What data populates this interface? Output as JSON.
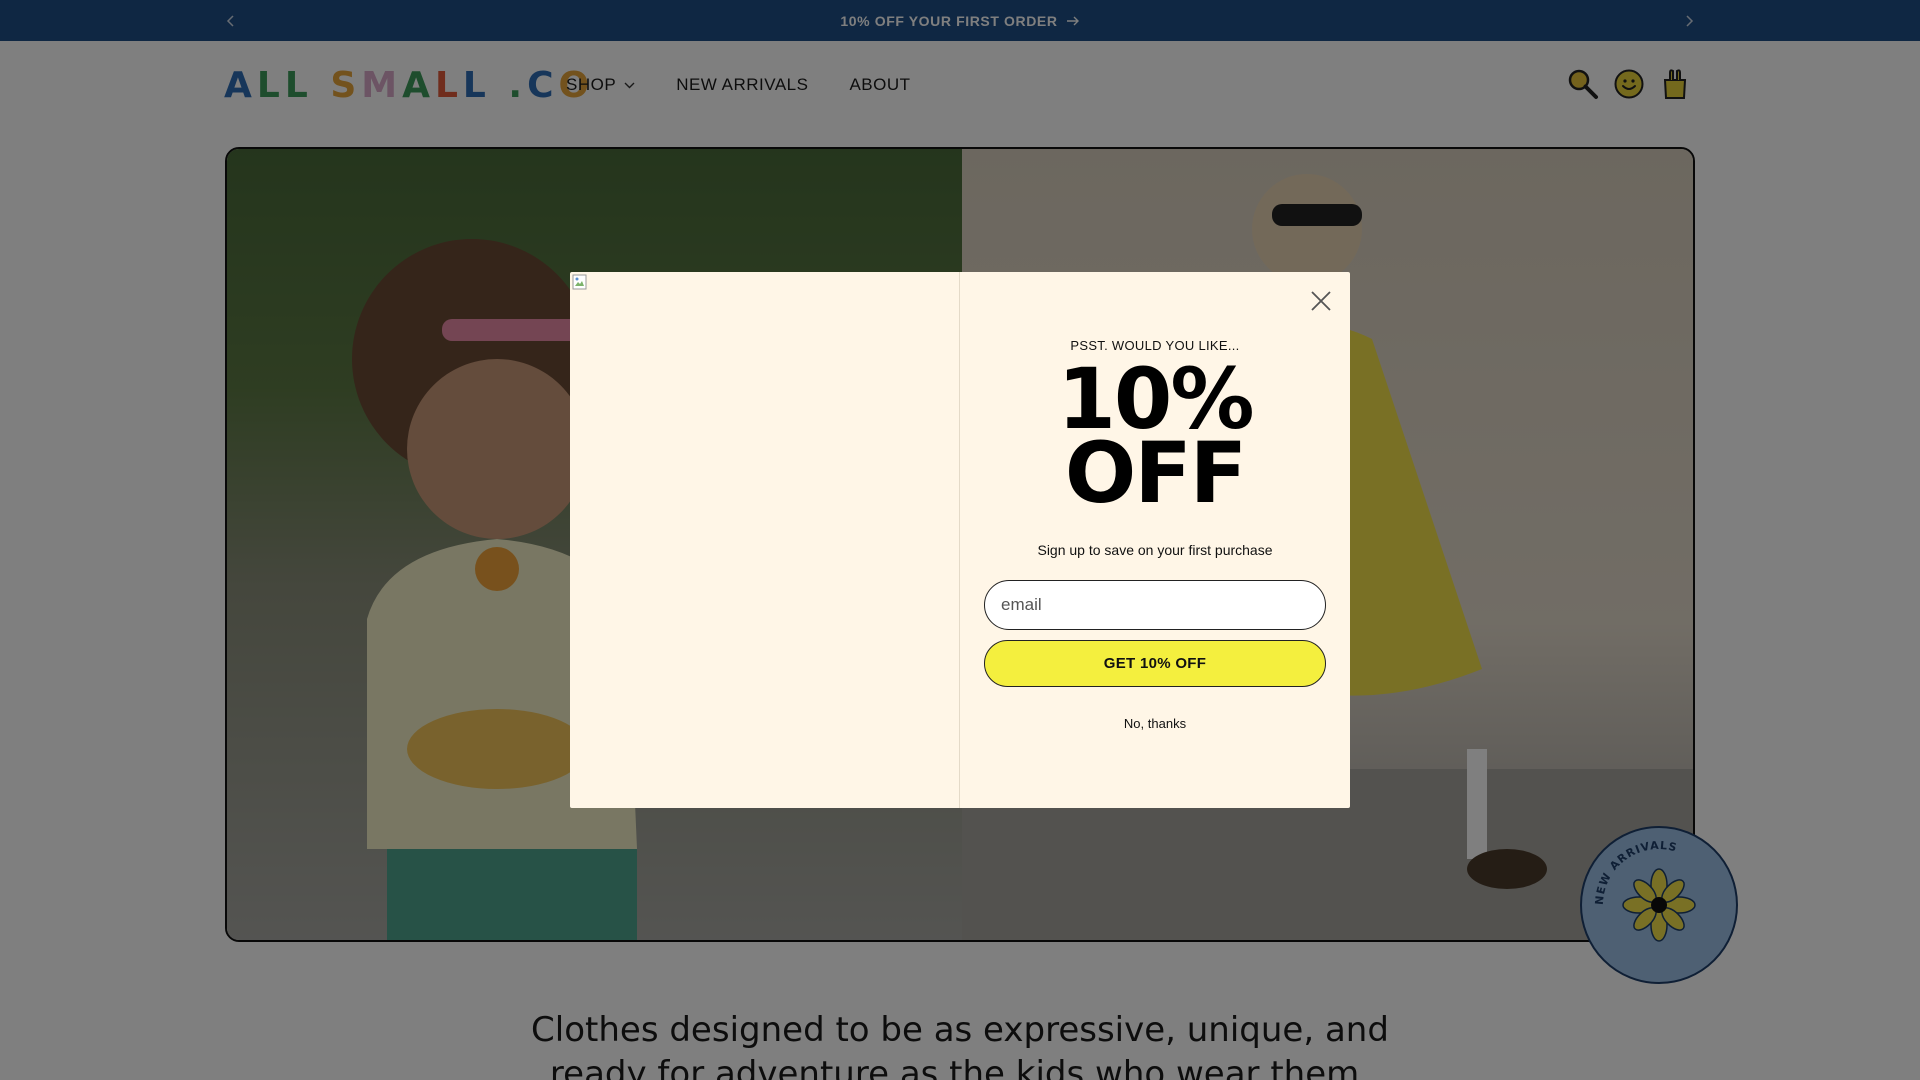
{
  "announcement": {
    "text": "10% OFF YOUR FIRST ORDER",
    "prev_icon": "chevron-left-icon",
    "next_icon": "chevron-right-icon",
    "arrow_icon": "arrow-right-icon"
  },
  "header": {
    "logo": {
      "text": "ALL SMALL .CO",
      "letters": [
        {
          "ch": "A",
          "color": "#2f6db5"
        },
        {
          "ch": "L",
          "color": "#3d9a5a"
        },
        {
          "ch": "L",
          "color": "#3d9a5a"
        },
        {
          "ch": " ",
          "color": "#000000"
        },
        {
          "ch": "S",
          "color": "#e6a43a"
        },
        {
          "ch": "M",
          "color": "#d9a8c9"
        },
        {
          "ch": "A",
          "color": "#3d9a5a"
        },
        {
          "ch": "L",
          "color": "#e05a3a"
        },
        {
          "ch": "L",
          "color": "#2f6db5"
        },
        {
          "ch": " ",
          "color": "#000000"
        },
        {
          "ch": ".",
          "color": "#3d9a5a"
        },
        {
          "ch": "C",
          "color": "#2f6db5"
        },
        {
          "ch": "O",
          "color": "#e6a43a"
        }
      ]
    },
    "nav": [
      {
        "label": "SHOP",
        "has_dropdown": true
      },
      {
        "label": "NEW ARRIVALS",
        "has_dropdown": false
      },
      {
        "label": "ABOUT",
        "has_dropdown": false
      }
    ],
    "icons": [
      "search-icon",
      "account-smiley-icon",
      "cart-bag-icon"
    ]
  },
  "tagline": {
    "line1": "Clothes designed to be as expressive, unique, and",
    "line2": "ready for adventure as the kids who wear them."
  },
  "badge": {
    "text": "NEW ARRIVALS"
  },
  "popup": {
    "eyebrow": "PSST. WOULD YOU LIKE...",
    "headline_line1": "10%",
    "headline_line2": "OFF",
    "subtext": "Sign up to save on your first purchase",
    "email_placeholder": "email",
    "submit_label": "GET 10% OFF",
    "dismiss_label": "No, thanks"
  },
  "colors": {
    "announcement_bg": "#1e4f86",
    "popup_bg": "#fff6e7",
    "submit_bg": "#f4ef3e",
    "overlay": "rgba(0,0,0,0.5)"
  }
}
